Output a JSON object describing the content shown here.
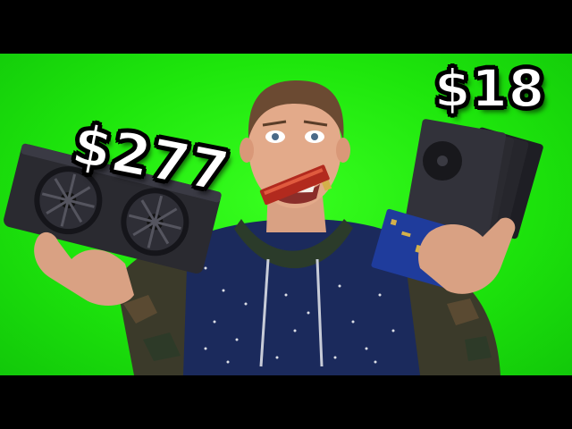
{
  "prices": {
    "left_label": "$277",
    "right_label": "$18"
  },
  "colors": {
    "background_green": "#1ee60c",
    "hoodie_navy": "#1b2a5c",
    "camo_dark": "#3b3a2a",
    "gpu_dark": "#2a2a30",
    "board_blue": "#1f3c9c",
    "card_red": "#b22a1e",
    "text_white": "#ffffff"
  }
}
